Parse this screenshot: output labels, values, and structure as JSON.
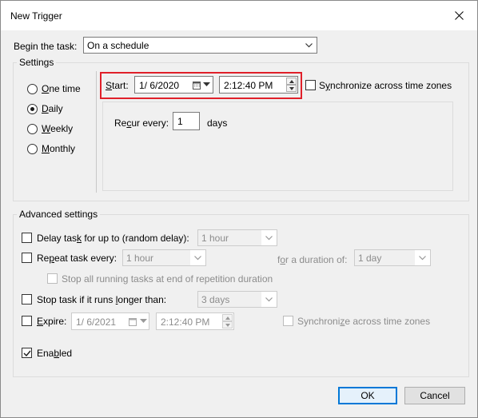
{
  "window": {
    "title": "New Trigger"
  },
  "begin": {
    "label_pre": "Begin the task:",
    "value": "On a schedule"
  },
  "settings": {
    "title": "Settings",
    "radios": [
      {
        "pre": "",
        "ul": "O",
        "post": "ne time",
        "checked": false
      },
      {
        "pre": "",
        "ul": "D",
        "post": "aily",
        "checked": true
      },
      {
        "pre": "",
        "ul": "W",
        "post": "eekly",
        "checked": false
      },
      {
        "pre": "",
        "ul": "M",
        "post": "onthly",
        "checked": false
      }
    ],
    "start_ul": "S",
    "start_post": "tart:",
    "start_date": "1/  6/2020",
    "start_time": "2:12:40 PM",
    "sync_pre": "S",
    "sync_ul": "y",
    "sync_post": "nchronize across time zones",
    "recur_pre": "Re",
    "recur_ul": "c",
    "recur_post": "ur every:",
    "recur_value": "1",
    "recur_unit": "days"
  },
  "advanced": {
    "title": "Advanced settings",
    "delay_pre": "Delay tas",
    "delay_ul": "k",
    "delay_post": " for up to (random delay):",
    "delay_value": "1 hour",
    "repeat_pre": "Re",
    "repeat_ul": "p",
    "repeat_post": "eat task every:",
    "repeat_value": "1 hour",
    "duration_pre": "f",
    "duration_ul": "o",
    "duration_post": "r a duration of:",
    "duration_value": "1 day",
    "stop_all_label": "Stop all running tasks at end of repetition duration",
    "stop_pre": "Stop task if it runs ",
    "stop_ul": "l",
    "stop_post": "onger than:",
    "stop_value": "3 days",
    "expire_pre": "",
    "expire_ul": "E",
    "expire_post": "xpire:",
    "expire_date": "1/  6/2021",
    "expire_time": "2:12:40 PM",
    "expire_sync_pre": "Synchroni",
    "expire_sync_ul": "z",
    "expire_sync_post": "e across time zones",
    "enabled_pre": "Ena",
    "enabled_ul": "b",
    "enabled_post": "led",
    "enabled_checked": true
  },
  "buttons": {
    "ok": "OK",
    "cancel": "Cancel"
  }
}
